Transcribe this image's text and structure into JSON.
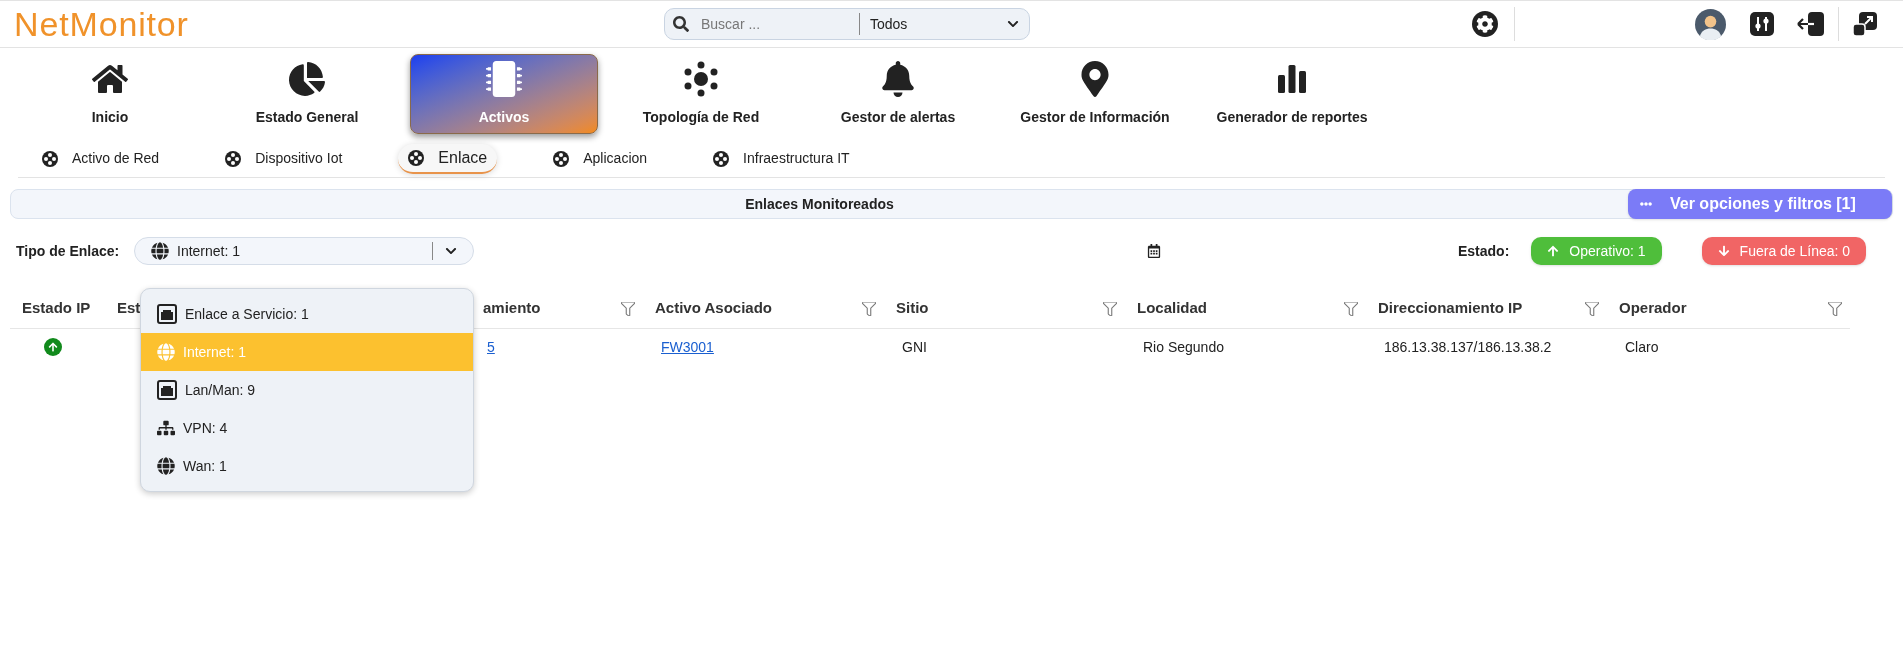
{
  "header": {
    "logo": "NetMonitor",
    "search": {
      "placeholder": "Buscar ...",
      "scope": "Todos"
    }
  },
  "nav": [
    {
      "label": "Inicio",
      "kind": "home",
      "selected": false
    },
    {
      "label": "Estado General",
      "kind": "pie",
      "selected": false
    },
    {
      "label": "Activos",
      "kind": "chip",
      "selected": true
    },
    {
      "label": "Topología de Red",
      "kind": "topology",
      "selected": false
    },
    {
      "label": "Gestor de alertas",
      "kind": "bell",
      "selected": false
    },
    {
      "label": "Gestor de Información",
      "kind": "pin",
      "selected": false
    },
    {
      "label": "Generador de reportes",
      "kind": "bars",
      "selected": false
    }
  ],
  "subtabs": [
    {
      "label": "Activo de Red",
      "selected": false
    },
    {
      "label": "Dispositivo Iot",
      "selected": false
    },
    {
      "label": "Enlace",
      "selected": true
    },
    {
      "label": "Aplicacion",
      "selected": false
    },
    {
      "label": "Infraestructura IT",
      "selected": false
    }
  ],
  "panel": {
    "title": "Enlaces Monitoreados",
    "options_button": "Ver opciones y filtros [1]"
  },
  "filter": {
    "label": "Tipo de Enlace:",
    "value": "Internet: 1",
    "options": [
      {
        "label": "Enlace a Servicio: 1",
        "kind": "ethernet",
        "selected": false
      },
      {
        "label": "Internet: 1",
        "kind": "globe",
        "selected": true
      },
      {
        "label": "Lan/Man: 9",
        "kind": "ethernet",
        "selected": false
      },
      {
        "label": "VPN: 4",
        "kind": "sitemap",
        "selected": false
      },
      {
        "label": "Wan: 1",
        "kind": "globe",
        "selected": false
      }
    ]
  },
  "status": {
    "label": "Estado:",
    "buttons": [
      {
        "label": "Operativo: 1",
        "kind": "up"
      },
      {
        "label": "Fuera de Línea: 0",
        "kind": "down"
      }
    ]
  },
  "table": {
    "columns": [
      {
        "label": "Estado IP",
        "filterable": false
      },
      {
        "label": "Est",
        "filterable": false
      },
      {
        "label": "amiento",
        "filterable": true
      },
      {
        "label": "Activo Asociado",
        "filterable": true
      },
      {
        "label": "Sitio",
        "filterable": true
      },
      {
        "label": "Localidad",
        "filterable": true
      },
      {
        "label": "Direccionamiento IP",
        "filterable": true
      },
      {
        "label": "Operador",
        "filterable": true
      }
    ],
    "rows": [
      {
        "cells": [
          {
            "kind": "status",
            "online": true
          },
          {
            "kind": "hidden"
          },
          {
            "kind": "link",
            "text": "5"
          },
          {
            "kind": "link",
            "text": "FW3001"
          },
          {
            "kind": "text",
            "text": "GNI"
          },
          {
            "kind": "text",
            "text": "Rio Segundo"
          },
          {
            "kind": "text",
            "text": "186.13.38.137/186.13.38.2"
          },
          {
            "kind": "text",
            "text": "Claro"
          }
        ]
      }
    ]
  }
}
